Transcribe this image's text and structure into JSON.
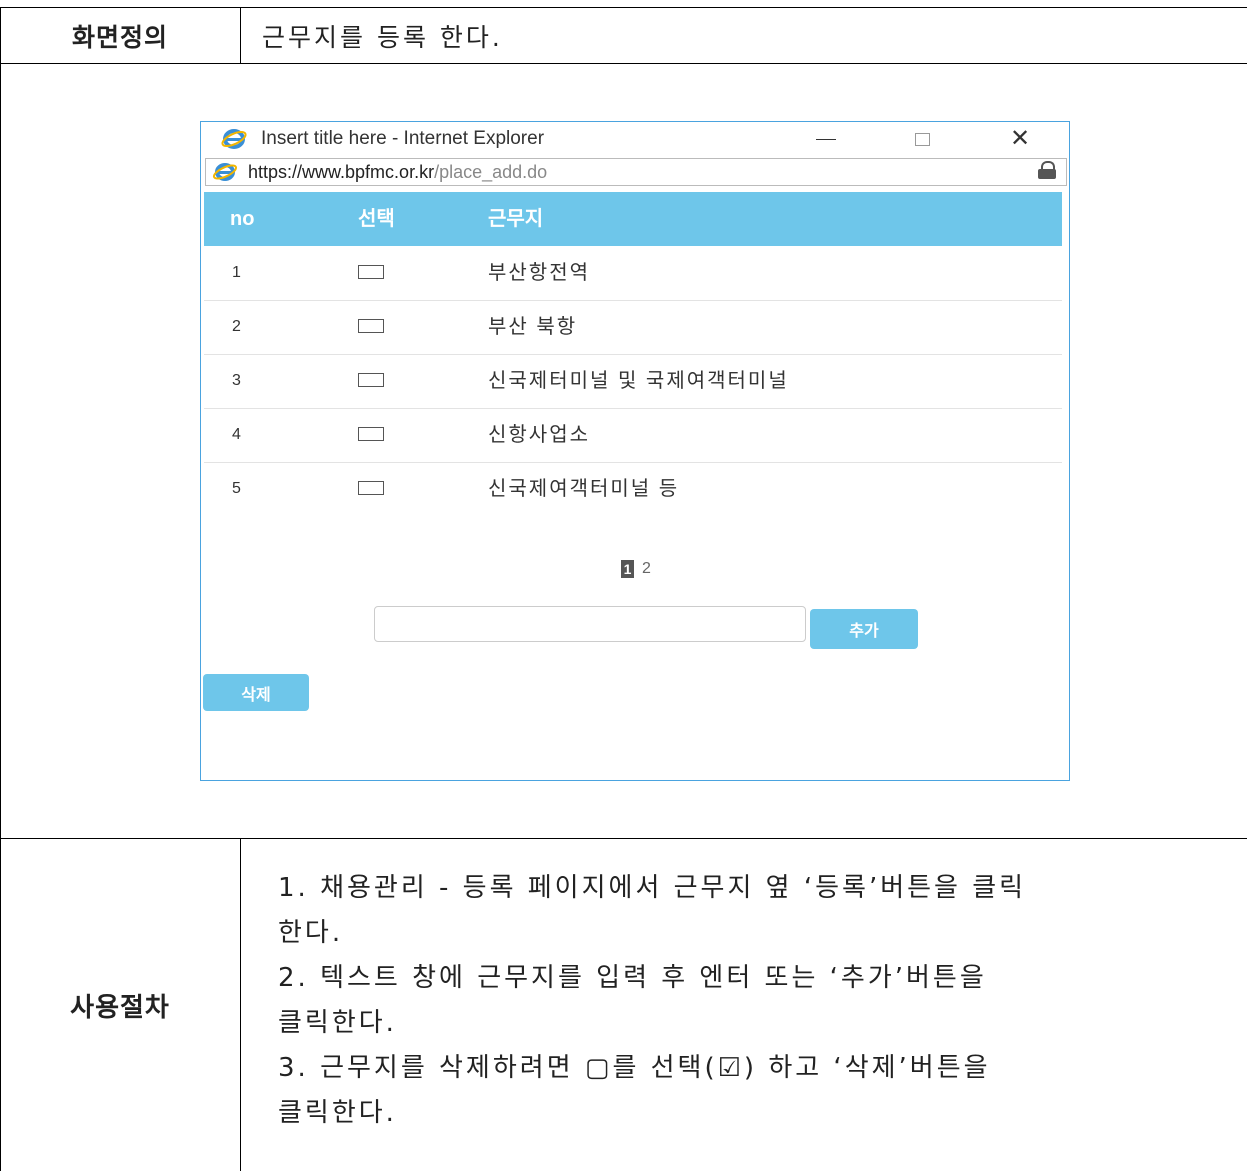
{
  "header": {
    "label": "화면정의",
    "description": "근무지를 등록 한다."
  },
  "window": {
    "title": "Insert title here - Internet Explorer",
    "url_scheme": "https://",
    "url_domain": "www.bpfmc.or.kr",
    "url_path": "/place_add.do",
    "close_glyph": "✕"
  },
  "grid": {
    "columns": [
      "no",
      "선택",
      "근무지"
    ],
    "rows": [
      {
        "no": "1",
        "place": "부산항전역"
      },
      {
        "no": "2",
        "place": "부산 북항"
      },
      {
        "no": "3",
        "place": "신국제터미널 및 국제여객터미널"
      },
      {
        "no": "4",
        "place": "신항사업소"
      },
      {
        "no": "5",
        "place": "신국제여객터미널 등"
      }
    ]
  },
  "pager": {
    "pages": [
      "1",
      "2"
    ],
    "current": "1"
  },
  "form": {
    "add_input_value": "",
    "add_button": "추가",
    "delete_button": "삭제"
  },
  "procedure": {
    "label": "사용절차",
    "lines": [
      "1. 채용관리 - 등록 페이지에서 근무지 옆 ‘등록’버튼을 클릭",
      "한다.",
      "2. 텍스트 창에 근무지를 입력 후 엔터 또는 ‘추가’버튼을",
      "클릭한다.",
      "3. 근무지를 삭제하려면 ▢를 선택(☑) 하고 ‘삭제’버튼을",
      "클릭한다."
    ]
  },
  "colors": {
    "grid_header": "#6ec6ea",
    "button": "#6ec6ea",
    "window_border": "#4aa3df"
  },
  "icons": [
    "ie-logo-icon",
    "minimize-icon",
    "maximize-icon",
    "close-icon",
    "lock-icon",
    "checkbox"
  ]
}
